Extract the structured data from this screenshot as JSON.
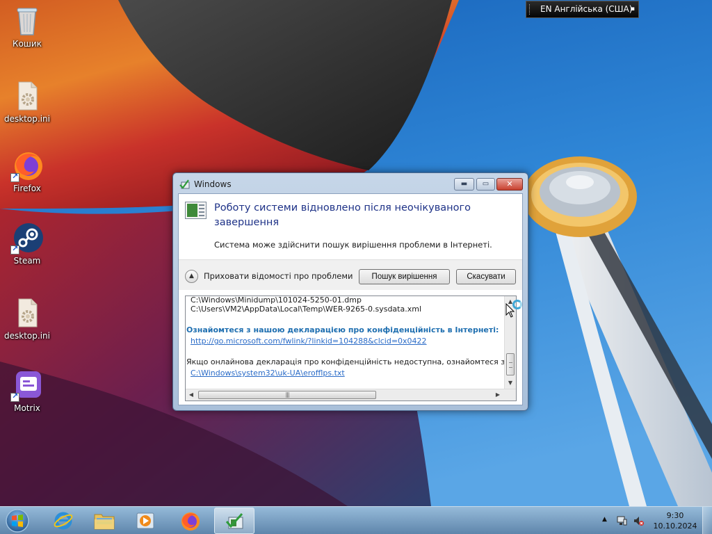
{
  "desktop": {
    "icons": [
      {
        "label": "Кошик",
        "icon": "recycle-bin-icon"
      },
      {
        "label": "desktop.ini",
        "icon": "settings-file-icon"
      },
      {
        "label": "Firefox",
        "icon": "firefox-icon"
      },
      {
        "label": "Steam",
        "icon": "steam-icon"
      },
      {
        "label": "desktop.ini",
        "icon": "settings-file-icon"
      },
      {
        "label": "Motrix",
        "icon": "motrix-icon"
      }
    ]
  },
  "language_bar": {
    "text": "EN Англійська (США)"
  },
  "dialog": {
    "title": "Windows",
    "main_instruction": "Роботу системи відновлено після неочікуваного завершення",
    "subtext": "Система може здійснити пошук вирішення проблеми в Інтернеті.",
    "toggle_details_label": "Приховати відомості про проблеми",
    "search_button": "Пошук вирішення",
    "cancel_button": "Скасувати",
    "details_lines": [
      "C:\\Windows\\Minidump\\101024-5250-01.dmp",
      "C:\\Users\\VM2\\AppData\\Local\\Temp\\WER-9265-0.sysdata.xml",
      "Ознайомтеся з нашою декларацією про конфіденційність в Інтернеті:",
      "http://go.microsoft.com/fwlink/?linkid=104288&clcid=0x0422",
      "Якщо онлайнова декларація про конфіденційність недоступна, ознайомтеся з наш",
      "C:\\Windows\\system32\\uk-UA\\erofflps.txt"
    ]
  },
  "taskbar": {
    "pinned": [
      "internet-explorer-icon",
      "explorer-folder-icon",
      "media-player-icon",
      "firefox-icon",
      "problem-reports-icon"
    ],
    "clock_time": "9:30",
    "clock_date": "10.10.2024"
  },
  "colors": {
    "dialog_title_text": "#1e3287",
    "link": "#2a6bc7",
    "privacy_heading": "#1f6fb0",
    "close_button": "#c8402e"
  }
}
